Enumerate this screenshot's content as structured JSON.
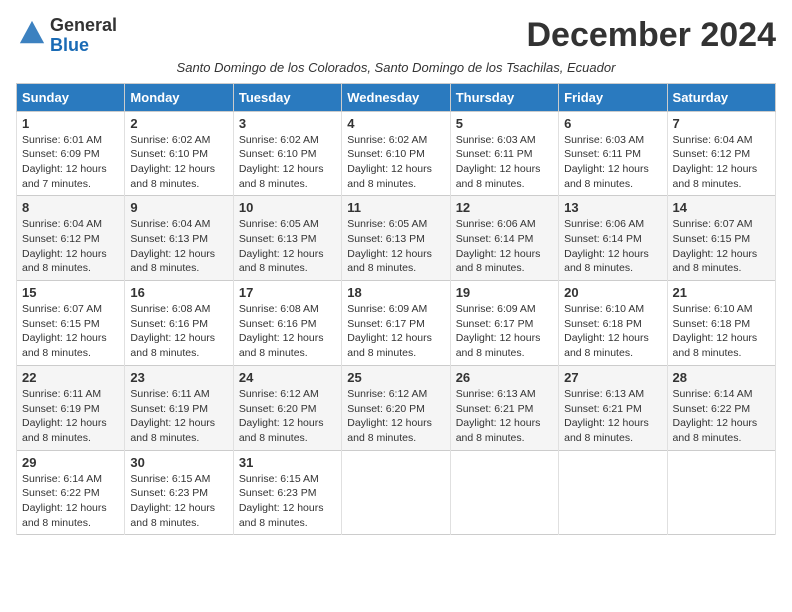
{
  "logo": {
    "general": "General",
    "blue": "Blue"
  },
  "title": "December 2024",
  "subtitle": "Santo Domingo de los Colorados, Santo Domingo de los Tsachilas, Ecuador",
  "days_of_week": [
    "Sunday",
    "Monday",
    "Tuesday",
    "Wednesday",
    "Thursday",
    "Friday",
    "Saturday"
  ],
  "weeks": [
    [
      {
        "day": "1",
        "sunrise": "6:01 AM",
        "sunset": "6:09 PM",
        "daylight": "12 hours and 7 minutes."
      },
      {
        "day": "2",
        "sunrise": "6:02 AM",
        "sunset": "6:10 PM",
        "daylight": "12 hours and 8 minutes."
      },
      {
        "day": "3",
        "sunrise": "6:02 AM",
        "sunset": "6:10 PM",
        "daylight": "12 hours and 8 minutes."
      },
      {
        "day": "4",
        "sunrise": "6:02 AM",
        "sunset": "6:10 PM",
        "daylight": "12 hours and 8 minutes."
      },
      {
        "day": "5",
        "sunrise": "6:03 AM",
        "sunset": "6:11 PM",
        "daylight": "12 hours and 8 minutes."
      },
      {
        "day": "6",
        "sunrise": "6:03 AM",
        "sunset": "6:11 PM",
        "daylight": "12 hours and 8 minutes."
      },
      {
        "day": "7",
        "sunrise": "6:04 AM",
        "sunset": "6:12 PM",
        "daylight": "12 hours and 8 minutes."
      }
    ],
    [
      {
        "day": "8",
        "sunrise": "6:04 AM",
        "sunset": "6:12 PM",
        "daylight": "12 hours and 8 minutes."
      },
      {
        "day": "9",
        "sunrise": "6:04 AM",
        "sunset": "6:13 PM",
        "daylight": "12 hours and 8 minutes."
      },
      {
        "day": "10",
        "sunrise": "6:05 AM",
        "sunset": "6:13 PM",
        "daylight": "12 hours and 8 minutes."
      },
      {
        "day": "11",
        "sunrise": "6:05 AM",
        "sunset": "6:13 PM",
        "daylight": "12 hours and 8 minutes."
      },
      {
        "day": "12",
        "sunrise": "6:06 AM",
        "sunset": "6:14 PM",
        "daylight": "12 hours and 8 minutes."
      },
      {
        "day": "13",
        "sunrise": "6:06 AM",
        "sunset": "6:14 PM",
        "daylight": "12 hours and 8 minutes."
      },
      {
        "day": "14",
        "sunrise": "6:07 AM",
        "sunset": "6:15 PM",
        "daylight": "12 hours and 8 minutes."
      }
    ],
    [
      {
        "day": "15",
        "sunrise": "6:07 AM",
        "sunset": "6:15 PM",
        "daylight": "12 hours and 8 minutes."
      },
      {
        "day": "16",
        "sunrise": "6:08 AM",
        "sunset": "6:16 PM",
        "daylight": "12 hours and 8 minutes."
      },
      {
        "day": "17",
        "sunrise": "6:08 AM",
        "sunset": "6:16 PM",
        "daylight": "12 hours and 8 minutes."
      },
      {
        "day": "18",
        "sunrise": "6:09 AM",
        "sunset": "6:17 PM",
        "daylight": "12 hours and 8 minutes."
      },
      {
        "day": "19",
        "sunrise": "6:09 AM",
        "sunset": "6:17 PM",
        "daylight": "12 hours and 8 minutes."
      },
      {
        "day": "20",
        "sunrise": "6:10 AM",
        "sunset": "6:18 PM",
        "daylight": "12 hours and 8 minutes."
      },
      {
        "day": "21",
        "sunrise": "6:10 AM",
        "sunset": "6:18 PM",
        "daylight": "12 hours and 8 minutes."
      }
    ],
    [
      {
        "day": "22",
        "sunrise": "6:11 AM",
        "sunset": "6:19 PM",
        "daylight": "12 hours and 8 minutes."
      },
      {
        "day": "23",
        "sunrise": "6:11 AM",
        "sunset": "6:19 PM",
        "daylight": "12 hours and 8 minutes."
      },
      {
        "day": "24",
        "sunrise": "6:12 AM",
        "sunset": "6:20 PM",
        "daylight": "12 hours and 8 minutes."
      },
      {
        "day": "25",
        "sunrise": "6:12 AM",
        "sunset": "6:20 PM",
        "daylight": "12 hours and 8 minutes."
      },
      {
        "day": "26",
        "sunrise": "6:13 AM",
        "sunset": "6:21 PM",
        "daylight": "12 hours and 8 minutes."
      },
      {
        "day": "27",
        "sunrise": "6:13 AM",
        "sunset": "6:21 PM",
        "daylight": "12 hours and 8 minutes."
      },
      {
        "day": "28",
        "sunrise": "6:14 AM",
        "sunset": "6:22 PM",
        "daylight": "12 hours and 8 minutes."
      }
    ],
    [
      {
        "day": "29",
        "sunrise": "6:14 AM",
        "sunset": "6:22 PM",
        "daylight": "12 hours and 8 minutes."
      },
      {
        "day": "30",
        "sunrise": "6:15 AM",
        "sunset": "6:23 PM",
        "daylight": "12 hours and 8 minutes."
      },
      {
        "day": "31",
        "sunrise": "6:15 AM",
        "sunset": "6:23 PM",
        "daylight": "12 hours and 8 minutes."
      },
      null,
      null,
      null,
      null
    ]
  ]
}
